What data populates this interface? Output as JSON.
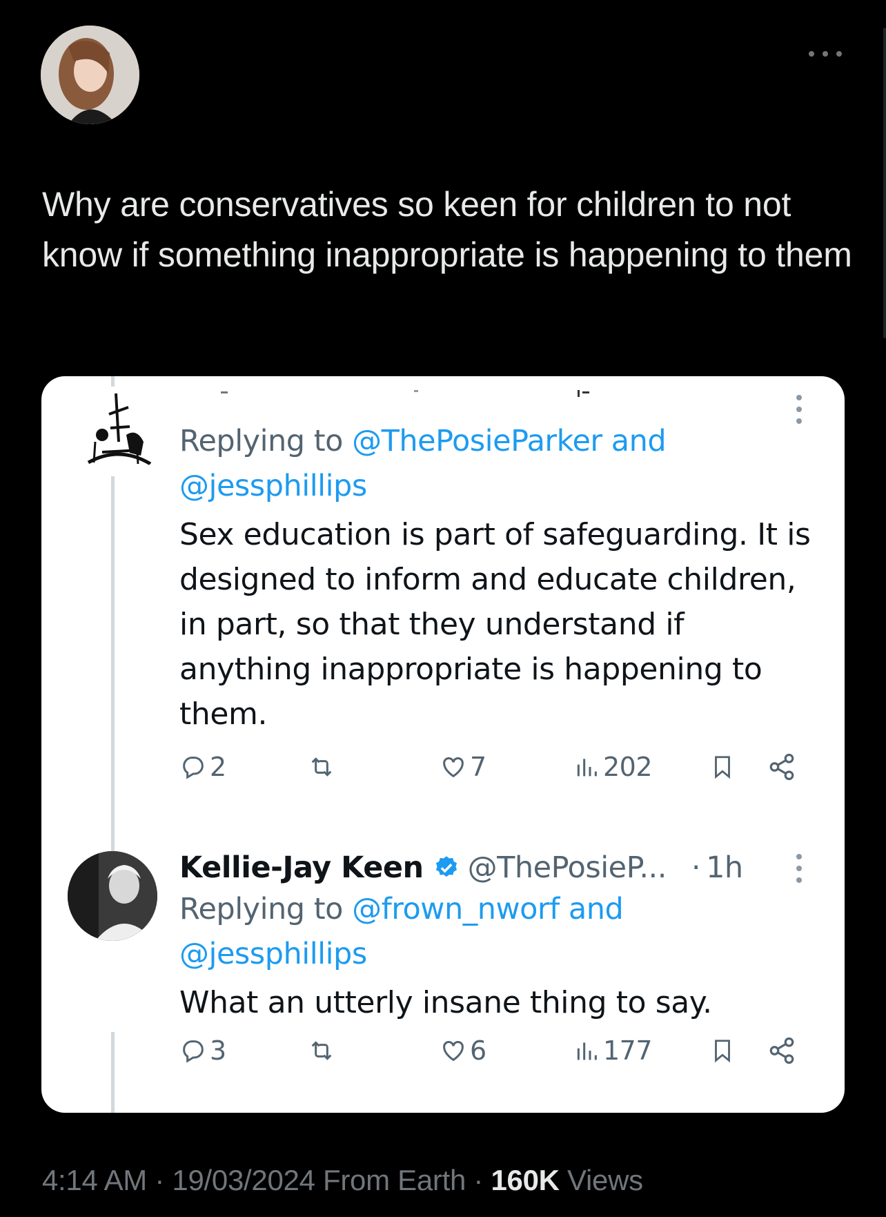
{
  "outer_tweet": {
    "text": "Why are conservatives so keen for children to not know if something inappropriate is happening to them",
    "timestamp": "4:14 AM · 19/03/2024 From Earth · ",
    "views_count": "160K",
    "views_label": " Views"
  },
  "quoted": {
    "first_reply": {
      "replying_prefix": "Replying to ",
      "mention_1": "@ThePosieParker",
      "and_word": " and",
      "mention_2": "@jessphillips",
      "text": "Sex education is part of safeguarding. It is designed to inform and educate children, in part, so that they understand if anything inappropriate is happening to them.",
      "stats": {
        "replies": "2",
        "likes": "7",
        "views": "202"
      }
    },
    "second_reply": {
      "name": "Kellie-Jay Keen",
      "handle": "@ThePosieP...",
      "dot": "·",
      "time": "1h",
      "replying_prefix": "Replying to ",
      "mention_1": "@frown_nworf",
      "and_word": " and",
      "mention_2": "@jessphillips",
      "text": "What an utterly insane thing to say.",
      "stats": {
        "replies": "3",
        "likes": "6",
        "views": "177"
      }
    }
  },
  "colors": {
    "background": "#000000",
    "card": "#ffffff",
    "link": "#1d9bf0",
    "secondary_text": "#536471",
    "verified": "#1d9bf0"
  },
  "icons": [
    "more-horizontal-icon",
    "more-vertical-icon",
    "reply-icon",
    "retweet-icon",
    "like-icon",
    "views-icon",
    "bookmark-icon",
    "share-icon",
    "verified-badge-icon"
  ]
}
